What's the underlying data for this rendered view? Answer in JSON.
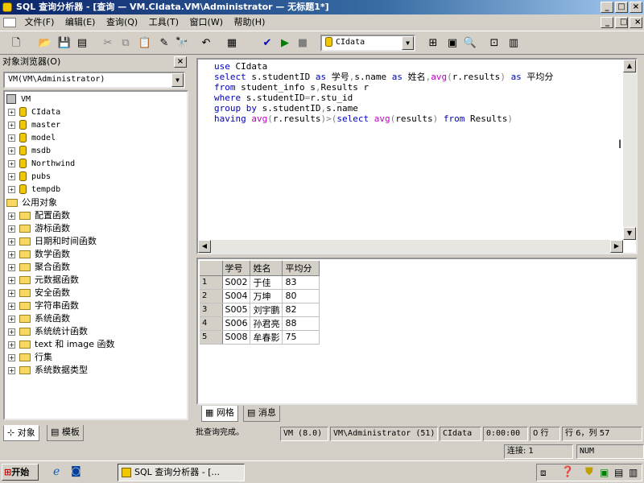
{
  "window": {
    "title": "SQL 查询分析器 - [查询 — VM.CIdata.VM\\Administrator — 无标题1*]"
  },
  "menu": [
    "文件(F)",
    "编辑(E)",
    "查询(Q)",
    "工具(T)",
    "窗口(W)",
    "帮助(H)"
  ],
  "toolbar": {
    "database": "CIdata"
  },
  "object_browser": {
    "title": "对象浏览器(O)",
    "server": "VM(VM\\Administrator)",
    "root": "VM",
    "databases": [
      "CIdata",
      "master",
      "model",
      "msdb",
      "Northwind",
      "pubs",
      "tempdb"
    ],
    "common_objects": "公用对象",
    "functions": [
      "配置函数",
      "游标函数",
      "日期和时间函数",
      "数学函数",
      "聚合函数",
      "元数据函数",
      "安全函数",
      "字符串函数",
      "系统函数",
      "系统统计函数",
      "text 和 image 函数",
      "行集",
      "系统数据类型"
    ],
    "tabs": [
      "对象",
      "模板"
    ]
  },
  "editor": {
    "lines": [
      "use CIdata",
      "select s.studentID as 学号,s.name as 姓名,avg(r.results) as 平均分",
      "from student_info s,Results r",
      "where s.studentID=r.stu_id",
      "group by s.studentID,s.name",
      "having avg(r.results)>(select avg(results) from Results)"
    ]
  },
  "results": {
    "columns": [
      "学号",
      "姓名",
      "平均分"
    ],
    "rows": [
      [
        "1",
        "S002",
        "于佳",
        "83"
      ],
      [
        "2",
        "S004",
        "万坤",
        "80"
      ],
      [
        "3",
        "S005",
        "刘宇鹏",
        "82"
      ],
      [
        "4",
        "S006",
        "孙君亮",
        "88"
      ],
      [
        "5",
        "S008",
        "牟春影",
        "75"
      ]
    ],
    "tabs": [
      "网格",
      "消息"
    ]
  },
  "status": {
    "message": "批查询完成。",
    "server": "VM (8.0)",
    "user": "VM\\Administrator (51)",
    "database": "CIdata",
    "elapsed": "0:00:00",
    "rows": "0 行",
    "position": "行 6，列 57",
    "connections": "连接: 1",
    "num": "NUM"
  },
  "taskbar": {
    "start": "开始",
    "task": "SQL 查询分析器 - [..."
  }
}
